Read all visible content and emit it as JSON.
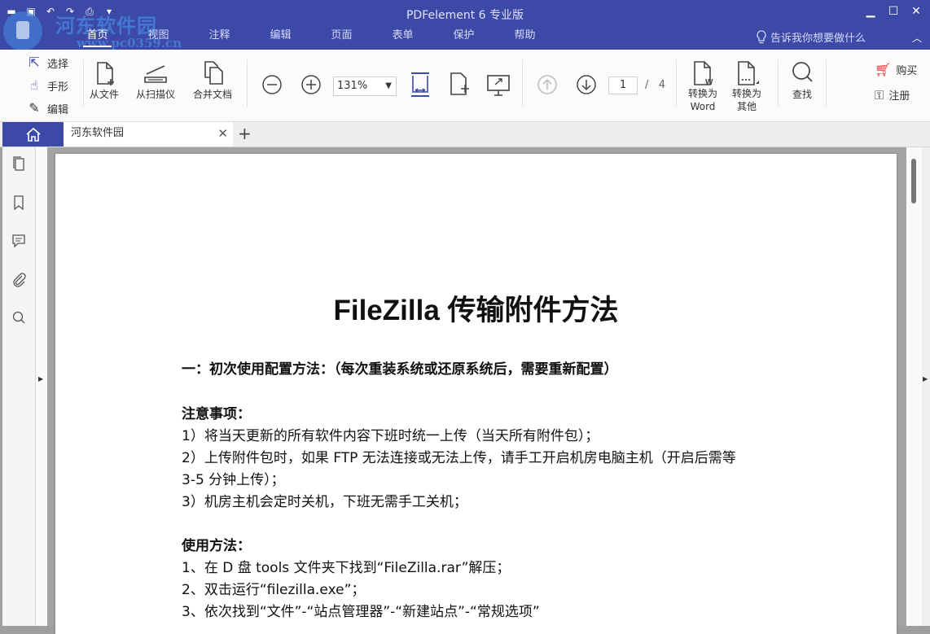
{
  "watermark": {
    "text": "河东软件园",
    "url": "www.pc0359.cn"
  },
  "app_title": "PDFelement 6 专业版",
  "menu": {
    "tabs": [
      "首页",
      "视图",
      "注释",
      "编辑",
      "页面",
      "表单",
      "保护",
      "帮助"
    ],
    "active_index": 0
  },
  "tell_me": "告诉我你想要做什么",
  "toolbar": {
    "select": "选择",
    "hand": "手形",
    "edit": "编辑",
    "from_file": "从文件",
    "from_scanner": "从扫描仪",
    "combine": "合并文档",
    "zoom": "131%",
    "current_page": "1",
    "page_sep": "/",
    "total_pages": "4",
    "to_word_1": "转换为",
    "to_word_2": "Word",
    "to_other_1": "转换为",
    "to_other_2": "其他",
    "find": "查找",
    "buy": "购买",
    "register": "注册"
  },
  "tabs": {
    "doc_tab": "河东软件园"
  },
  "document": {
    "title": "FileZilla 传输附件方法",
    "heading1": "一：初次使用配置方法：（每次重装系统或还原系统后，需要重新配置）",
    "notes_heading": "注意事项：",
    "note1": "1）将当天更新的所有软件内容下班时统一上传（当天所有附件包）；",
    "note2a": "2）上传附件包时，如果 FTP 无法连接或无法上传，请手工开启机房电脑主机（开启后需等",
    "note2b": "3-5 分钟上传）；",
    "note3": "3）机房主机会定时关机，下班无需手工关机；",
    "usage_heading": "使用方法：",
    "step1": "1、在 D 盘 tools 文件夹下找到“FileZilla.rar”解压；",
    "step2": "2、双击运行“filezilla.exe”；",
    "step3": "3、依次找到“文件”-“站点管理器”-“新建站点”-“常规选项”"
  },
  "colors": {
    "brand": "#3d49a6",
    "accent_red": "#e03030"
  }
}
